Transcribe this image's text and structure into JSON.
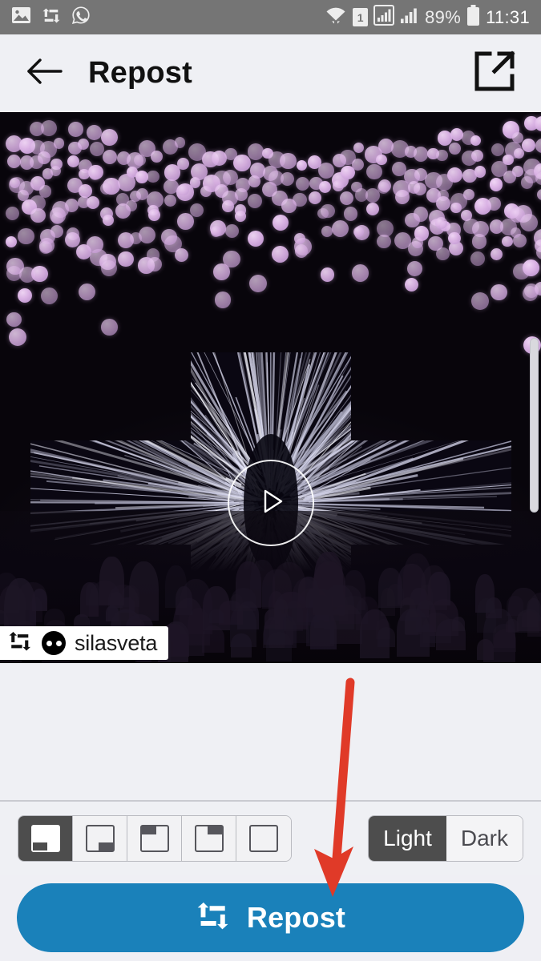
{
  "status_bar": {
    "background": "#757575",
    "left_icons": [
      {
        "name": "image-icon",
        "label": "Image"
      },
      {
        "name": "repost-icon",
        "label": "Repost"
      },
      {
        "name": "whatsapp-icon",
        "label": "WhatsApp"
      }
    ],
    "wifi_icon": "wifi-icon",
    "sim_label": "1",
    "signal_icons": [
      "signal-sim1-icon",
      "signal-sim2-icon"
    ],
    "battery_percent": "89%",
    "battery_icon": "battery-icon",
    "time": "11:31"
  },
  "header": {
    "back_icon": "back-arrow-icon",
    "title": "Repost",
    "share_icon": "share-external-icon",
    "background": "#EFF0F4"
  },
  "preview": {
    "media_type": "video",
    "play_icon": "play-icon",
    "watermark": {
      "repost_icon": "repost-icon",
      "avatar": "user-avatar",
      "username": "silasveta",
      "position": "bottom-left",
      "theme": "Light"
    },
    "scrollbar": "vertical-scrollbar"
  },
  "controls": {
    "position_options": [
      {
        "name": "position-bottom-left",
        "label": "Bottom left",
        "mark": "m-bl",
        "selected": true
      },
      {
        "name": "position-bottom-right",
        "label": "Bottom right",
        "mark": "m-br",
        "selected": false
      },
      {
        "name": "position-top-left",
        "label": "Top left",
        "mark": "m-tl",
        "selected": false
      },
      {
        "name": "position-top-right",
        "label": "Top right",
        "mark": "m-tr",
        "selected": false
      },
      {
        "name": "position-none",
        "label": "No watermark",
        "mark": "",
        "selected": false
      }
    ],
    "theme_options": [
      {
        "name": "theme-light",
        "label": "Light",
        "selected": true
      },
      {
        "name": "theme-dark",
        "label": "Dark",
        "selected": false
      }
    ],
    "selected_color": "#4D4D4D"
  },
  "primary_action": {
    "icon": "repost-icon",
    "label": "Repost",
    "color": "#1A81BA"
  },
  "annotation": {
    "type": "arrow",
    "color": "#E03A28",
    "points_to": "Repost"
  }
}
